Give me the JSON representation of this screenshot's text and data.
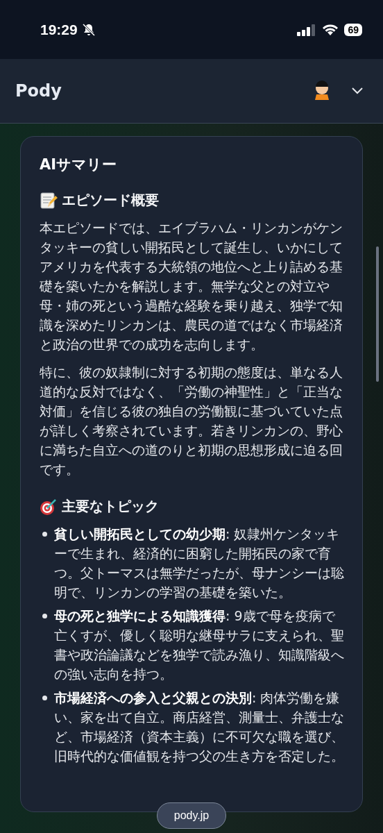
{
  "status_bar": {
    "time": "19:29",
    "battery": "69"
  },
  "header": {
    "title": "Pody"
  },
  "card": {
    "title": "AIサマリー",
    "sections": [
      {
        "kind": "paragraphs",
        "heading": "エピソード概要",
        "paragraphs": [
          "本エピソードでは、エイブラハム・リンカンがケンタッキーの貧しい開拓民として誕生し、いかにしてアメリカを代表する大統領の地位へと上り詰める基礎を築いたかを解説します。無学な父との対立や母・姉の死という過酷な経験を乗り越え、独学で知識を深めたリンカンは、農民の道ではなく市場経済と政治の世界での成功を志向します。",
          "特に、彼の奴隷制に対する初期の態度は、単なる人道的な反対ではなく、「労働の神聖性」と「正当な対価」を信じる彼の独自の労働観に基づいていた点が詳しく考察されています。若きリンカンの、野心に満ちた自立への道のりと初期の思想形成に迫る回です。"
        ]
      },
      {
        "kind": "bullets",
        "heading": "主要なトピック",
        "items": [
          "**貧しい開拓民としての幼少期**: 奴隷州ケンタッキーで生まれ、経済的に困窮した開拓民の家で育つ。父トーマスは無学だったが、母ナンシーは聡明で、リンカンの学習の基礎を築いた。",
          "**母の死と独学による知識獲得**: 9歳で母を疫病で亡くすが、優しく聡明な継母サラに支えられ、聖書や政治論議などを独学で読み漁り、知識階級への強い志向を持つ。",
          "**市場経済への参入と父親との決別**: 肉体労働を嫌い、家を出て自立。商店経営、測量士、弁護士など、市場経済（資本主義）に不可欠な職を選び、旧時代的な価値観を持つ父の生き方を否定した。"
        ]
      }
    ]
  },
  "url_bar": {
    "domain": "pody.jp"
  }
}
